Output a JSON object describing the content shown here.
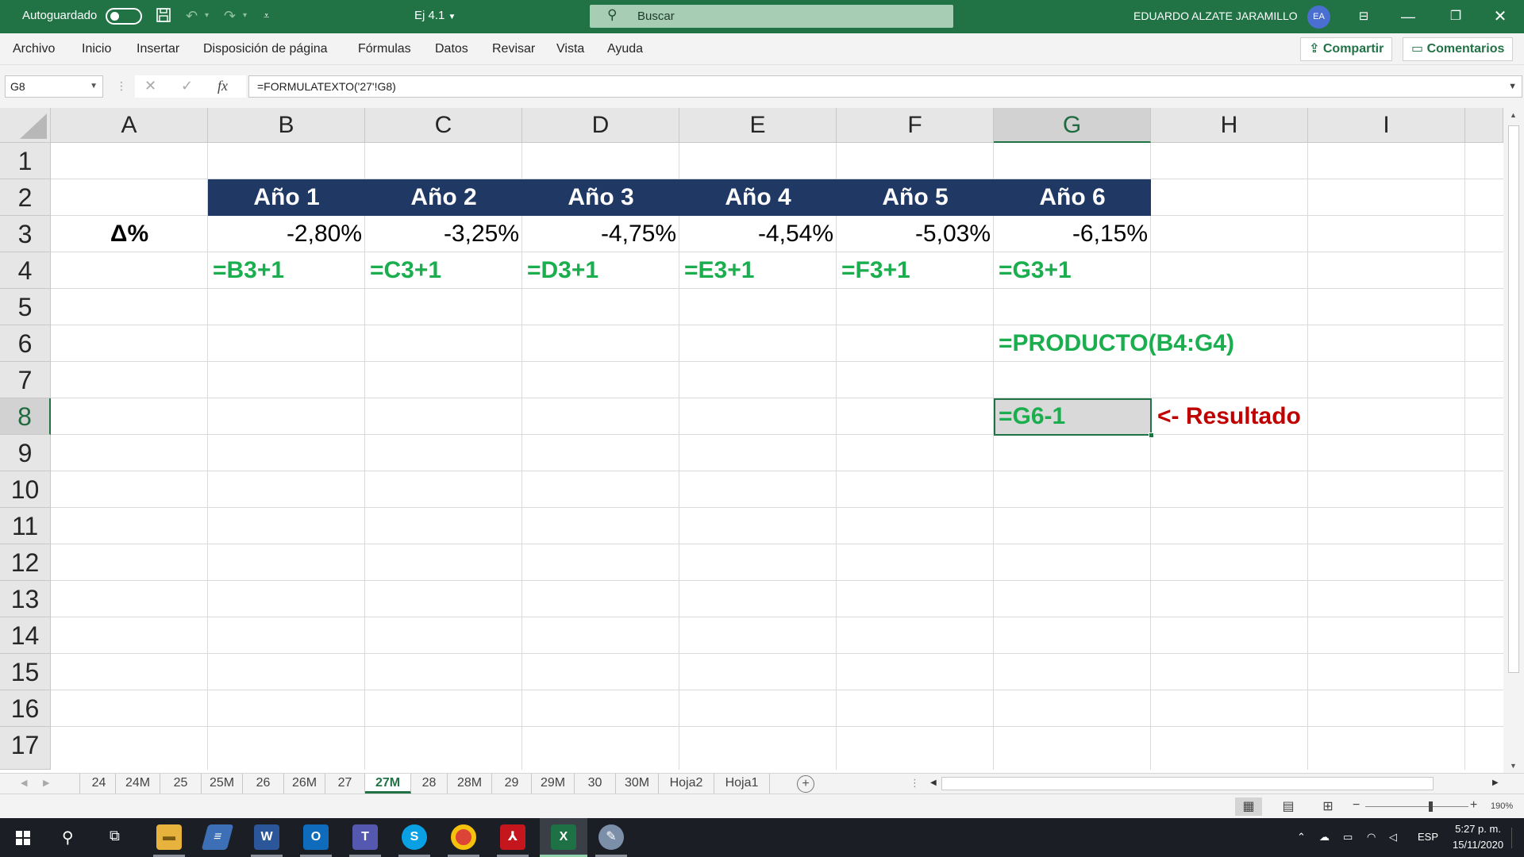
{
  "titlebar": {
    "autosave_label": "Autoguardado",
    "doc_title": "Ej 4.1",
    "search_placeholder": "Buscar",
    "user_name": "EDUARDO ALZATE JARAMILLO",
    "user_initials": "EA"
  },
  "menu": {
    "items": [
      "Archivo",
      "Inicio",
      "Insertar",
      "Disposición de página",
      "Fórmulas",
      "Datos",
      "Revisar",
      "Vista",
      "Ayuda"
    ],
    "share_label": "Compartir",
    "comments_label": "Comentarios"
  },
  "formula_bar": {
    "name_box": "G8",
    "formula": "=FORMULATEXTO('27'!G8)",
    "fx_label": "fx"
  },
  "grid": {
    "columns": [
      "A",
      "B",
      "C",
      "D",
      "E",
      "F",
      "G",
      "H",
      "I"
    ],
    "rows": [
      "1",
      "2",
      "3",
      "4",
      "5",
      "6",
      "7",
      "8",
      "9",
      "10",
      "11",
      "12",
      "13",
      "14",
      "15",
      "16",
      "17"
    ],
    "selected_column": "G",
    "selected_row": "8",
    "header_fill": "#1f3864",
    "year_headers": [
      "Año 1",
      "Año 2",
      "Año 3",
      "Año 4",
      "Año 5",
      "Año 6"
    ],
    "delta_label": "Δ%",
    "deltas": [
      "-2,80%",
      "-3,25%",
      "-4,75%",
      "-4,54%",
      "-5,03%",
      "-6,15%"
    ],
    "row4_formulas": [
      "=B3+1",
      "=C3+1",
      "=D3+1",
      "=E3+1",
      "=F3+1",
      "=G3+1"
    ],
    "product_formula": "=PRODUCTO(B4:G4)",
    "result_formula": "=G6-1",
    "result_note": "<- Resultado",
    "formula_color": "#1aae4e",
    "note_color": "#c00000"
  },
  "sheets": {
    "tabs": [
      "24",
      "24M",
      "25",
      "25M",
      "26",
      "26M",
      "27",
      "27M",
      "28",
      "28M",
      "29",
      "29M",
      "30",
      "30M",
      "Hoja2",
      "Hoja1"
    ],
    "active": "27M"
  },
  "statusbar": {
    "zoom": "190%"
  },
  "taskbar": {
    "language": "ESP",
    "time": "5:27 p. m.",
    "date": "15/11/2020"
  },
  "accent_color": "#217346"
}
